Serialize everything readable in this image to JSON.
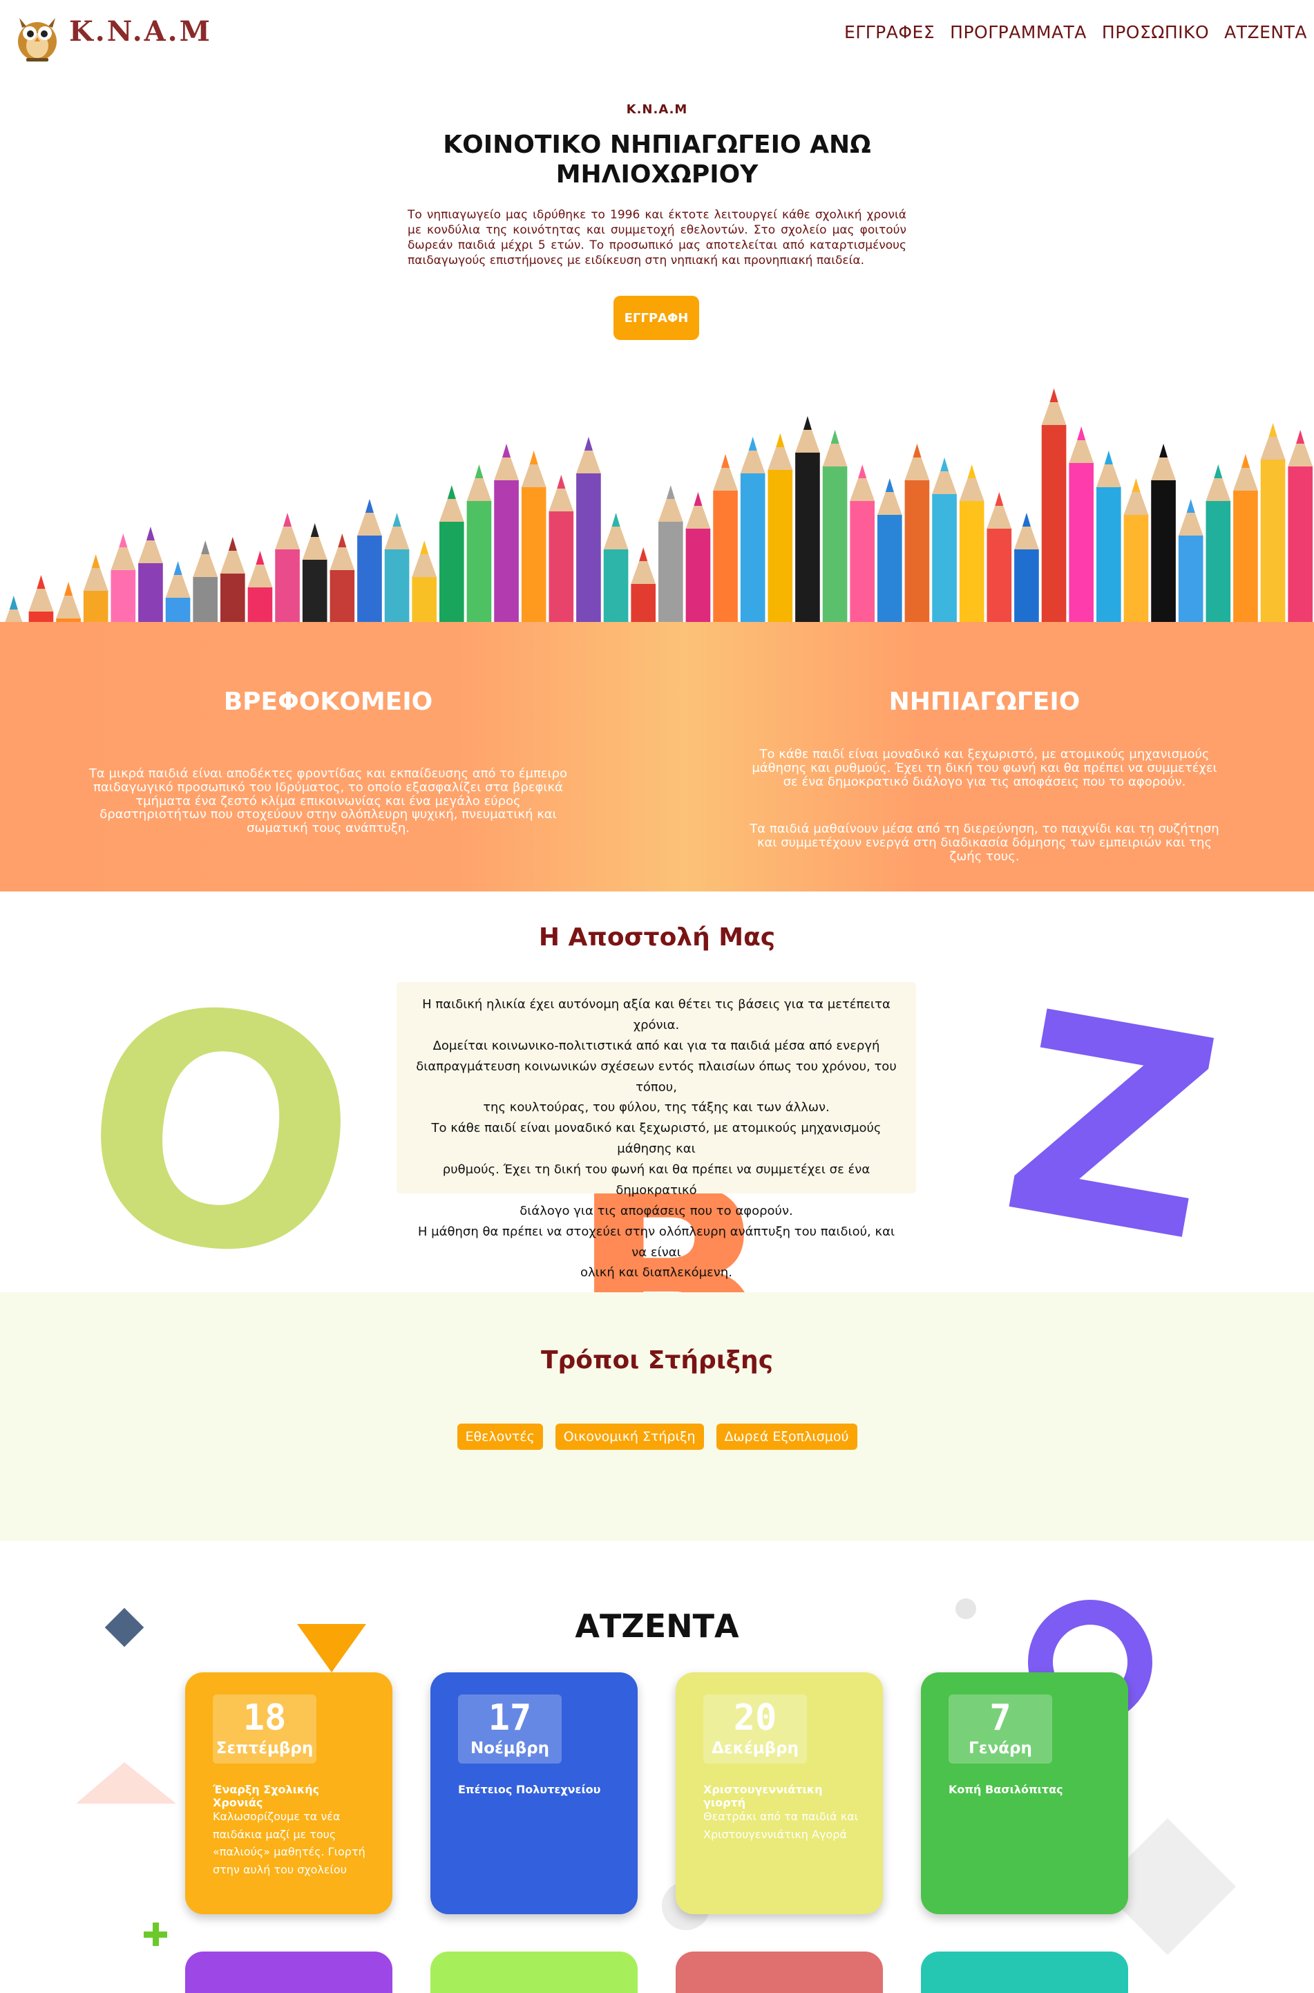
{
  "header": {
    "logo_text": "K.N.A.M",
    "nav": [
      "ΕΓΓΡΑΦΕΣ",
      "ΠΡΟΓΡΑΜΜΑΤΑ",
      "ΠΡΟΣΩΠΙΚΟ",
      "ΑΤΖΕΝΤΑ"
    ]
  },
  "hero": {
    "kicker": "K.N.A.M",
    "title": "ΚΟΙΝΟΤΙΚΟ ΝΗΠΙΑΓΩΓΕΙΟ ΑΝΩ ΜΗΛΙΟΧΩΡΙΟΥ",
    "text": "Το νηπιαγωγείο μας ιδρύθηκε το 1996 και έκτοτε λειτουργεί κάθε σχολική χρονιά με κονδύλια της κοινότητας και συμμετοχή εθελοντών. Στο σχολείο μας φοιτούν δωρεάν παιδιά μέχρι 5 ετών. Το προσωπικό μας αποτελείται από καταρτισμένους παιδαγωγούς επιστήμονες με ειδίκευση στη νηπιακή και προνηπιακή παιδεία.",
    "button": "ΕΓΓΡΑΦΗ"
  },
  "programs": {
    "left": {
      "title": "ΒΡΕΦΟΚΟΜΕΙΟ",
      "text": "Τα μικρά παιδιά είναι αποδέκτες φροντίδας και εκπαίδευσης από το έμπειρο παιδαγωγικό προσωπικό του Ιδρύματος, το οποίο εξασφαλίζει στα βρεφικά τμήματα ένα ζεστό κλίμα επικοινωνίας και ένα μεγάλο εύρος δραστηριοτήτων που στοχεύουν στην ολόπλευρη ψυχική, πνευματική και σωματική τους ανάπτυξη."
    },
    "right": {
      "title": "ΝΗΠΙΑΓΩΓΕΙΟ",
      "text1": "Το κάθε παιδί είναι μοναδικό και ξεχωριστό, με ατομικούς μηχανισμούς μάθησης και ρυθμούς. Έχει τη δική του φωνή και θα πρέπει να συμμετέχει σε ένα δημοκρατικό διάλογο για τις αποφάσεις που το αφορούν.",
      "text2": "Τα παιδιά μαθαίνουν μέσα από τη διερεύνηση, το παιχνίδι και τη συζήτηση και συμμετέχουν ενεργά στη διαδικασία δόμησης των εμπειριών και της ζωής τους."
    }
  },
  "mission": {
    "title": "Η Αποστολή Μας",
    "lines": [
      "Η παιδική ηλικία έχει αυτόνομη αξία και θέτει τις βάσεις για τα μετέπειτα χρόνια.",
      "Δομείται κοινωνικο-πολιτιστικά από και για τα παιδιά μέσα από ενεργή",
      "διαπραγμάτευση κοινωνικών σχέσεων εντός πλαισίων όπως του χρόνου, του τόπου,",
      "της κουλτούρας, του φύλου, της τάξης και των άλλων.",
      "Το κάθε παιδί είναι μοναδικό και ξεχωριστό, με ατομικούς μηχανισμούς μάθησης και",
      "ρυθμούς. Έχει τη δική του φωνή και θα πρέπει να συμμετέχει σε ένα δημοκρατικό",
      "διάλογο για τις αποφάσεις που το αφορούν.",
      "Η μάθηση θα πρέπει να στοχεύει στην ολόπλευρη ανάπτυξη του παιδιού, και να είναι",
      "ολική και διαπλεκόμενη."
    ],
    "letters": [
      "O",
      "B",
      "Z"
    ]
  },
  "support": {
    "title": "Τρόποι Στήριξης",
    "buttons": [
      "Εθελοντές",
      "Οικονομική Στήριξη",
      "Δωρεά Εξοπλισμού"
    ]
  },
  "agenda": {
    "title": "ΑΤΖΕΝΤΑ",
    "cards": [
      {
        "day": "18",
        "month": "Σεπτέμβρη",
        "title": "Έναρξη Σχολικής Χρονιάς",
        "desc": "Καλωσορίζουμε τα νέα παιδάκια μαζί με τους «παλιούς» μαθητές. Γιορτή στην αυλή του σχολείου",
        "color": "#fbb117"
      },
      {
        "day": "17",
        "month": "Νοέμβρη",
        "title": "Επέτειος Πολυτεχνείου",
        "desc": "",
        "color": "#3360dc"
      },
      {
        "day": "20",
        "month": "Δεκέμβρη",
        "title": "Χριστουγεννιάτικη γιορτή",
        "desc": "Θεατράκι από τα παιδιά και Χριστουγεννιάτικη Αγορά",
        "color": "#e9ea7a"
      },
      {
        "day": "7",
        "month": "Γενάρη",
        "title": "Κοπή Βασιλόπιτας",
        "desc": "",
        "color": "#4bc24b"
      }
    ],
    "bottom_colors": [
      "#9c47e6",
      "#a7ef5a",
      "#e06f6f",
      "#25c7b3"
    ]
  },
  "colors": {
    "accent": "#fba405",
    "brand_dark_red": "#6b1212",
    "band_orange": "#ffa06a"
  }
}
